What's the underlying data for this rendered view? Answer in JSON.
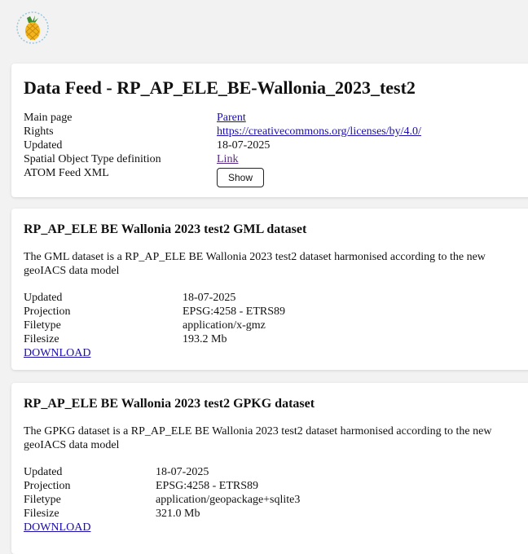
{
  "logo": {
    "icon": "pineapple-logo-icon"
  },
  "feed": {
    "title": "Data Feed - RP_AP_ELE_BE-Wallonia_2023_test2",
    "rows": [
      {
        "key": "Main page",
        "value": "Parent",
        "type": "link"
      },
      {
        "key": "Rights",
        "value": "https://creativecommons.org/licenses/by/4.0/",
        "type": "link"
      },
      {
        "key": "Updated",
        "value": "18-07-2025",
        "type": "text"
      },
      {
        "key": "Spatial Object Type definition",
        "value": "Link",
        "type": "visited-link"
      },
      {
        "key": "ATOM Feed XML",
        "value": "Show",
        "type": "button"
      }
    ]
  },
  "datasets": [
    {
      "title": "RP_AP_ELE BE Wallonia 2023 test2 GML dataset",
      "description": "The GML dataset is a RP_AP_ELE BE Wallonia 2023 test2 dataset harmonised according to the new geoIACS data model",
      "updated_label": "Updated",
      "updated": "18-07-2025",
      "projection_label": "Projection",
      "projection": "EPSG:4258 - ETRS89",
      "filetype_label": "Filetype",
      "filetype": "application/x-gmz",
      "filesize_label": "Filesize",
      "filesize": "193.2 Mb",
      "download": "DOWNLOAD"
    },
    {
      "title": "RP_AP_ELE BE Wallonia 2023 test2 GPKG dataset",
      "description": "The GPKG dataset is a RP_AP_ELE BE Wallonia 2023 test2 dataset harmonised according to the new geoIACS data model",
      "updated_label": "Updated",
      "updated": "18-07-2025",
      "projection_label": "Projection",
      "projection": "EPSG:4258 - ETRS89",
      "filetype_label": "Filetype",
      "filetype": "application/geopackage+sqlite3",
      "filesize_label": "Filesize",
      "filesize": "321.0 Mb",
      "download": "DOWNLOAD"
    }
  ],
  "colors": {
    "link": "#1a0dab",
    "visited_link": "#5b2a86",
    "background": "#f2f2f2",
    "card": "#ffffff"
  }
}
